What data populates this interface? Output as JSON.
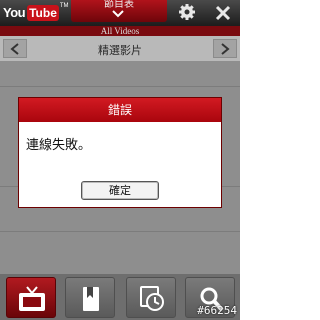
{
  "app": {
    "logo_you": "You",
    "logo_tube": "Tube",
    "logo_tm": "TM"
  },
  "header": {
    "menu_label": "節目表",
    "subtitle": "All Videos"
  },
  "nav": {
    "title": "精選影片"
  },
  "dialog": {
    "title": "錯誤",
    "message": "連線失敗。",
    "ok_label": "確定"
  },
  "toolbar": {
    "items": [
      {
        "icon": "tv-icon",
        "selected": true
      },
      {
        "icon": "bookmark-icon",
        "selected": false
      },
      {
        "icon": "history-icon",
        "selected": false
      },
      {
        "icon": "search-icon",
        "selected": false
      }
    ]
  },
  "watermark": "#66254"
}
